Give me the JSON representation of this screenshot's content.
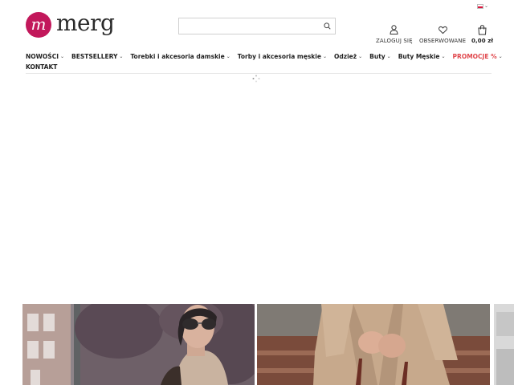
{
  "brand": {
    "name": "merg",
    "logo_letter": "m",
    "accent": "#c2185b"
  },
  "lang": {
    "icon": "flag-icon"
  },
  "search": {
    "placeholder": "",
    "value": ""
  },
  "account": {
    "login_label": "ZALOGUJ SIĘ",
    "wishlist_label": "OBSERWOWANE",
    "cart_total": "0,00 zł"
  },
  "nav": {
    "items": [
      {
        "label": "NOWOŚCI"
      },
      {
        "label": "BESTSELLERY"
      },
      {
        "label": "Torebki i akcesoria damskie"
      },
      {
        "label": "Torby i akcesoria męskie"
      },
      {
        "label": "Odzież"
      },
      {
        "label": "Buty"
      },
      {
        "label": "Buty Męskie"
      },
      {
        "label": "PROMOCJE %",
        "color": "#e0474c"
      },
      {
        "label": "KONTAKT"
      }
    ]
  }
}
